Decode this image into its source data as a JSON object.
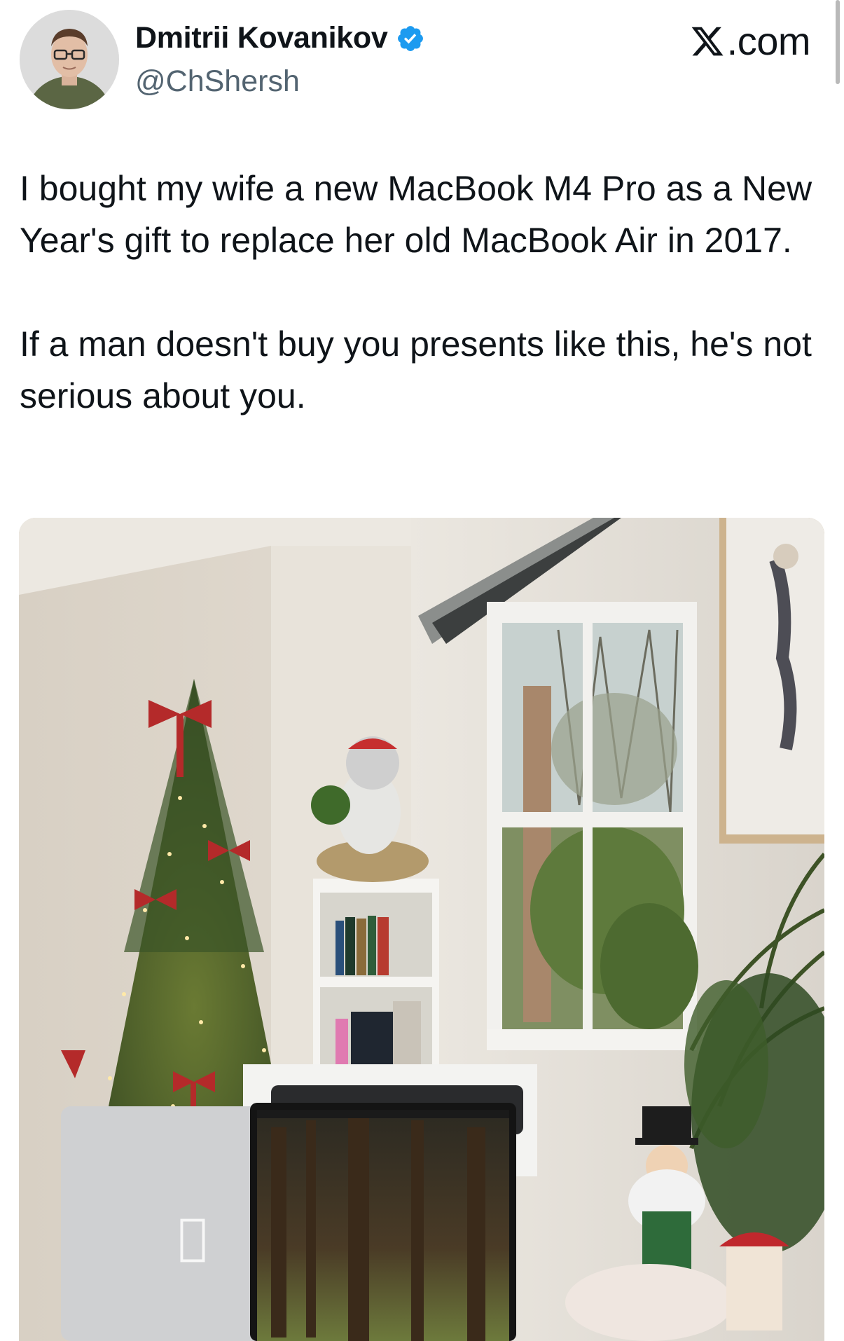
{
  "author": {
    "display_name": "Dmitrii Kovanikov",
    "handle": "@ChShersh",
    "verified": true,
    "verified_color": "#1d9bf0",
    "avatar_icon": "profile-photo"
  },
  "site": {
    "label": ".com",
    "logo_icon": "x-logo-icon"
  },
  "tweet": {
    "paragraphs": [
      "I bought my wife a new MacBook M4 Pro as a New Year's gift to replace her old MacBook Air in 2017.",
      "If a man doesn't buy you presents like this, he's not serious about you."
    ]
  },
  "media": {
    "type": "photo",
    "apple_logo": ""
  },
  "colors": {
    "text": "#0f1419",
    "secondary_text": "#536471",
    "accent": "#1d9bf0"
  }
}
